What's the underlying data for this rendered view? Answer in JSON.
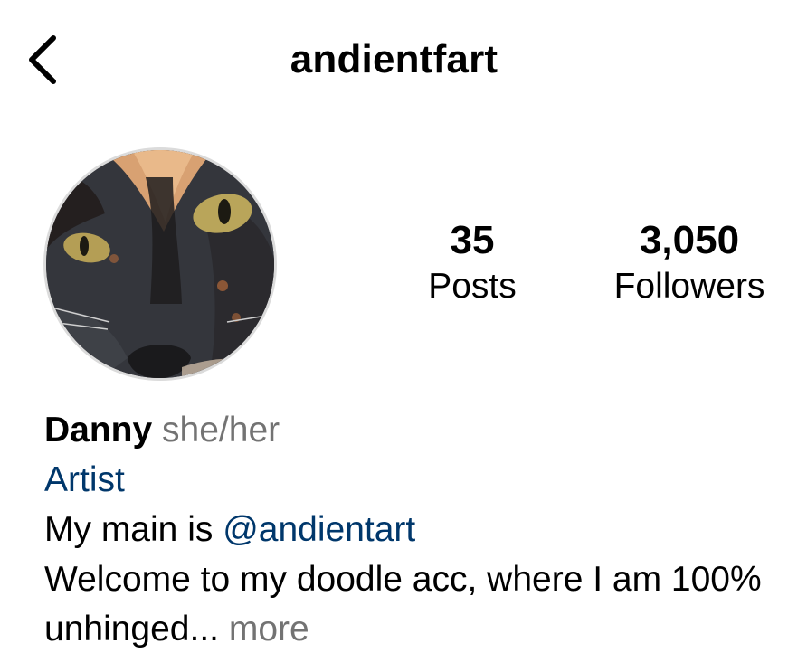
{
  "header": {
    "username": "andientfart",
    "back_icon": "chevron-left-icon"
  },
  "profile": {
    "avatar_icon": "profile-picture-cat",
    "stats": {
      "posts_count": "35",
      "posts_label": "Posts",
      "followers_count": "3,050",
      "followers_label": "Followers"
    },
    "bio": {
      "name": "Danny",
      "pronouns": "she/her",
      "category": "Artist",
      "line1_prefix": "My main is ",
      "mention": "@andientart",
      "line2": "Welcome to my doodle acc, where I am 100%",
      "line3": "unhinged...",
      "more": "more"
    }
  },
  "colors": {
    "link": "#00376b",
    "secondary_text": "#737373",
    "avatar_ring": "#dbdbdb"
  }
}
